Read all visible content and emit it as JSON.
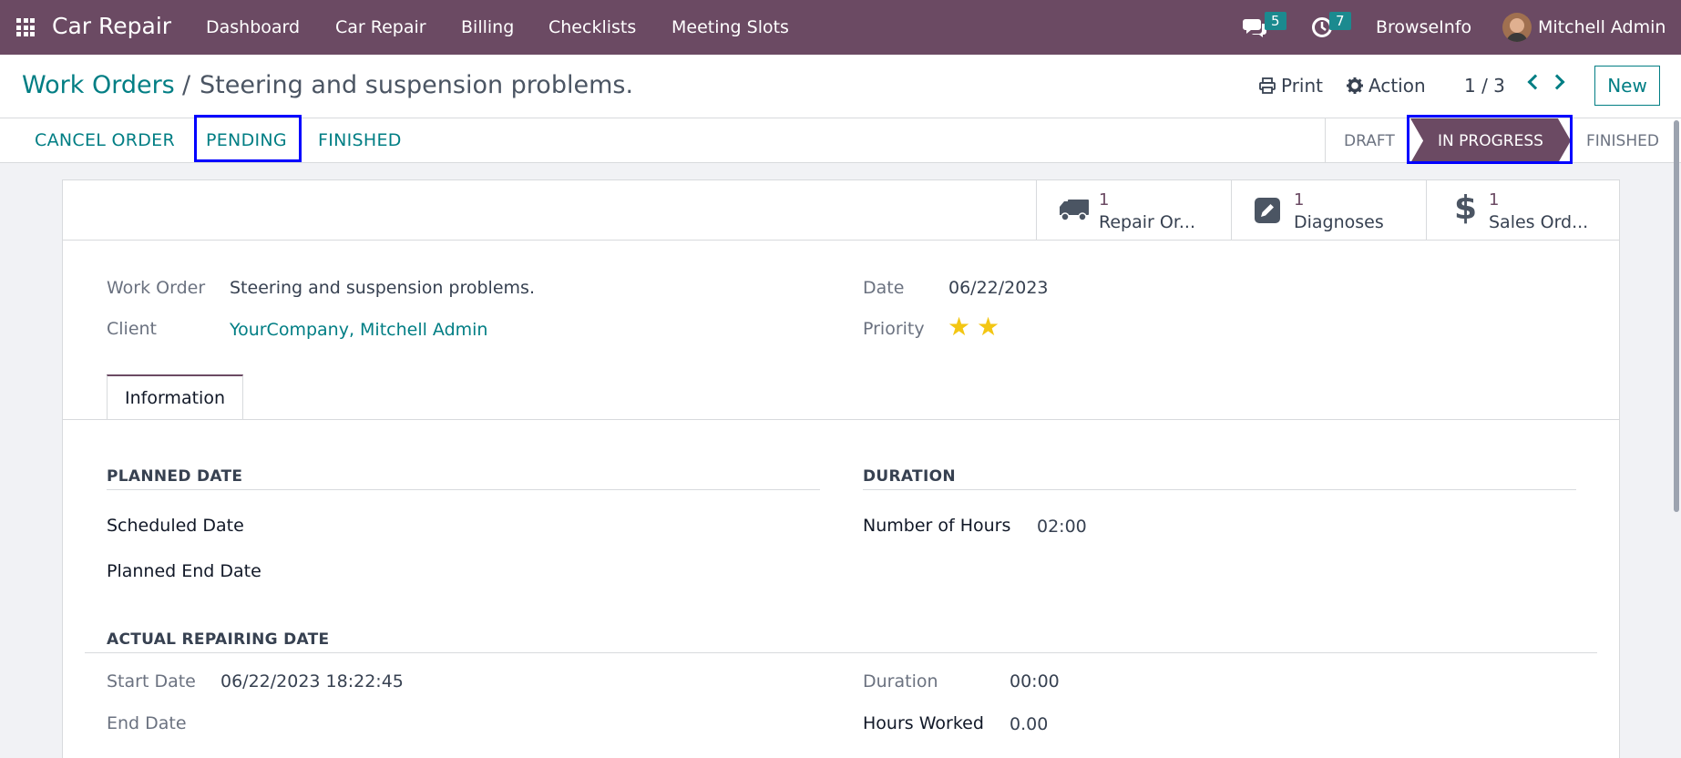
{
  "app": {
    "brand": "Car Repair",
    "menu": [
      "Dashboard",
      "Car Repair",
      "Billing",
      "Checklists",
      "Meeting Slots"
    ],
    "messages_count": "5",
    "activities_count": "7",
    "company": "BrowseInfo",
    "user": "Mitchell Admin"
  },
  "control_panel": {
    "breadcrumb_parent": "Work Orders",
    "breadcrumb_separator": "/",
    "breadcrumb_current": "Steering and suspension problems.",
    "print_label": "Print",
    "action_label": "Action",
    "pager": "1 / 3",
    "new_label": "New"
  },
  "statusbar": {
    "buttons": [
      "CANCEL ORDER",
      "PENDING",
      "FINISHED"
    ],
    "stages": [
      "DRAFT",
      "IN PROGRESS",
      "FINISHED"
    ],
    "active_stage": "IN PROGRESS"
  },
  "smart_buttons": [
    {
      "count": "1",
      "label": "Repair Or...",
      "icon": "truck-icon"
    },
    {
      "count": "1",
      "label": "Diagnoses",
      "icon": "pencil-square-icon"
    },
    {
      "count": "1",
      "label": "Sales Ord...",
      "icon": "dollar-icon"
    }
  ],
  "form": {
    "work_order_label": "Work Order",
    "work_order_value": "Steering and suspension problems.",
    "client_label": "Client",
    "client_value": "YourCompany, Mitchell Admin",
    "date_label": "Date",
    "date_value": "06/22/2023",
    "priority_label": "Priority",
    "priority_stars": 2
  },
  "tabs": [
    "Information"
  ],
  "info": {
    "planned_header": "PLANNED DATE",
    "scheduled_label": "Scheduled Date",
    "planned_end_label": "Planned End Date",
    "duration_header": "DURATION",
    "hours_label": "Number of Hours",
    "hours_value": "02:00",
    "actual_header": "ACTUAL REPAIRING DATE",
    "start_label": "Start Date",
    "start_value": "06/22/2023 18:22:45",
    "end_label": "End Date",
    "duration_label": "Duration",
    "duration_value": "00:00",
    "worked_label": "Hours Worked",
    "worked_value": "0.00"
  },
  "colors": {
    "brand": "#6b4a63",
    "link": "#017e84",
    "highlight": "#0000ff",
    "star": "#f3c613"
  }
}
